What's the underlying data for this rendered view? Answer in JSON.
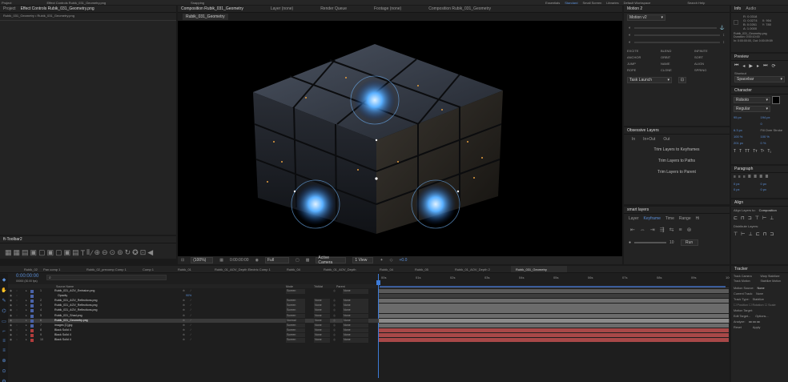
{
  "menu": {
    "items": [
      "Project",
      "",
      "Effect Controls Rubik_031_Geometry.png",
      "",
      "",
      "",
      "",
      "",
      "Snapping",
      "",
      "",
      "",
      "Essentials",
      "Standard",
      "Small Screen",
      "Libraries",
      "Default Workspace",
      "",
      "Search Help"
    ]
  },
  "effect_controls": {
    "subtitle": "Rubik_031_Geometry • Rubik_031_Geometry.png"
  },
  "comp": {
    "header_tabs": [
      "Composition Rubik_031_Geometry",
      "Layer (none)",
      "Render Queue",
      "Footage (none)",
      "Composition Rubik_031_Geometry"
    ],
    "sub_tab": "Rubik_031_Geometry",
    "footer": {
      "zoom": "(100%)",
      "timecode": "0:00:00:00",
      "resolution": "Full",
      "camera": "Active Camera",
      "views": "1 View",
      "plus": "+0.0"
    }
  },
  "toolbar2": {
    "title": "ft-Toolbar2"
  },
  "motion2": {
    "title": "Motion 2",
    "preset": "Motion v2",
    "buttons": [
      "EXCITE",
      "BLEND",
      "INFINITE",
      "ANCHOR",
      "ORBIT",
      "SORT",
      "JUMP",
      "NAME",
      "ALIGN",
      "ROPE",
      "CLONE",
      "SPRING"
    ],
    "task_label": "Task Launch"
  },
  "obsessive": {
    "title": "Obsessive Layers",
    "opts": [
      "In",
      "In+Out",
      "Out"
    ],
    "buttons": [
      "Trim Layers to Keyframes",
      "Trim Layers to Paths",
      "Trim Layers to Parent"
    ]
  },
  "smart": {
    "title": "smart layers",
    "tabs": [
      "Layer",
      "Keyframe",
      "Time",
      "Range",
      "Hi"
    ],
    "value": "10",
    "run": "Run"
  },
  "info": {
    "tabs": [
      "Info",
      "Audio"
    ],
    "lines": [
      "R: 0.0318",
      "G: 0.0274",
      "B: 0.0261",
      "A: 1.0000"
    ],
    "xy": [
      "X: 904",
      "Y: 780"
    ],
    "file": [
      "Rubik_031_Geometry.png",
      "Duration: 0:00:10:00",
      "In: 0:00:00:00, Out: 0:00:09:59"
    ]
  },
  "preview": {
    "title": "Preview",
    "shortcut_label": "Shortcut",
    "shortcut": "Spacebar"
  },
  "character": {
    "title": "Character",
    "font": "Roboto",
    "style": "Regular",
    "size": "95 px",
    "leading": "194 px",
    "kern": "",
    "track": "0",
    "stroke": "6.3 px",
    "fill": "Fill Over Stroke",
    "vscale": "100 %",
    "hscale": "100 %",
    "baseline": "201 px",
    "tsume": "0 %"
  },
  "paragraph": {
    "title": "Paragraph",
    "vals": [
      "0 px",
      "0 px",
      "0 px",
      "0 px",
      "0 px"
    ]
  },
  "align": {
    "title": "Align",
    "align_to_label": "Align Layers to:",
    "align_to": "Composition",
    "distribute": "Distribute Layers:"
  },
  "tracker": {
    "title": "Tracker",
    "buttons": [
      "Track Camera",
      "Warp Stabilizer",
      "Track Motion",
      "Stabilize Motion"
    ],
    "rows": [
      "Motion Source:",
      "Current Track:",
      "Track Type:",
      "Motion Target:",
      "Edit Target...",
      "Options...",
      "Analyze:",
      "Reset",
      "Apply"
    ],
    "values": [
      "None",
      "None",
      "Stabilize"
    ]
  },
  "timeline": {
    "tabs": [
      "Rubik_02",
      "Pan comp 1",
      "Rubik_02_precomp Comp 1",
      "Comp 1",
      "Rubik_01",
      "Rubik_01_AOV_Depth Electric Comp 1",
      "Rubik_04",
      "Rubik_01_AOV_Depth",
      "Rubik_04",
      "Rubik_05",
      "Rubik_01_AOV_Depth 2",
      "Rubik_031_Geometry"
    ],
    "timecode": "0:00:00:00",
    "fps": "00000 (30.00 fps)",
    "col_headers": {
      "name": "Source Name",
      "mode": "Mode",
      "trkmat": "TrkMat",
      "parent": "Parent"
    },
    "ruler": [
      "00s",
      "01s",
      "02s",
      "03s",
      "04s",
      "05s",
      "06s",
      "07s",
      "08s",
      "09s",
      "10s"
    ],
    "layers": [
      {
        "num": "1",
        "name": "Rubik_031_AOV_Emission.png",
        "mode": "Screen",
        "trk": "",
        "parent": "None",
        "color": "#4a63a8",
        "bar": "#5a5a5a"
      },
      {
        "num": "",
        "name": "Opacity",
        "mode": "",
        "trk": "",
        "parent": "",
        "color": "#4a63a8",
        "bar": "#3d3d3d",
        "val": "90%"
      },
      {
        "num": "2",
        "name": "Rubik_031_AOV_Reflections.png",
        "mode": "Screen",
        "trk": "None",
        "parent": "None",
        "color": "#4a63a8",
        "bar": "#6b6b6b"
      },
      {
        "num": "3",
        "name": "Rubik_031_AOV_Reflections.png",
        "mode": "Screen",
        "trk": "None",
        "parent": "None",
        "color": "#4a63a8",
        "bar": "#6b6b6b"
      },
      {
        "num": "4",
        "name": "Rubik_031_AOV_Reflections.png",
        "mode": "Screen",
        "trk": "None",
        "parent": "None",
        "color": "#4a63a8",
        "bar": "#6b6b6b"
      },
      {
        "num": "5",
        "name": "Rubik_031_Shad.png",
        "mode": "Screen",
        "trk": "None",
        "parent": "None",
        "color": "#4a63a8",
        "bar": "#6b6b6b"
      },
      {
        "num": "6",
        "name": "Rubik_031_Geometry.png",
        "mode": "Normal",
        "trk": "None",
        "parent": "None",
        "color": "#4a63a8",
        "bar": "#8a8a8a",
        "sel": true
      },
      {
        "num": "7",
        "name": "images [1].jpg",
        "mode": "Screen",
        "trk": "None",
        "parent": "None",
        "color": "#4a63a8",
        "bar": "#6b6b6b"
      },
      {
        "num": "8",
        "name": "Black Solid 4",
        "mode": "Screen",
        "trk": "None",
        "parent": "None",
        "color": "#b13c3c",
        "bar": "#a84848"
      },
      {
        "num": "9",
        "name": "Black Solid 4",
        "mode": "Screen",
        "trk": "None",
        "parent": "None",
        "color": "#b13c3c",
        "bar": "#a84848"
      },
      {
        "num": "10",
        "name": "Black Solid 4",
        "mode": "Screen",
        "trk": "None",
        "parent": "None",
        "color": "#b13c3c",
        "bar": "#a84848"
      }
    ]
  }
}
